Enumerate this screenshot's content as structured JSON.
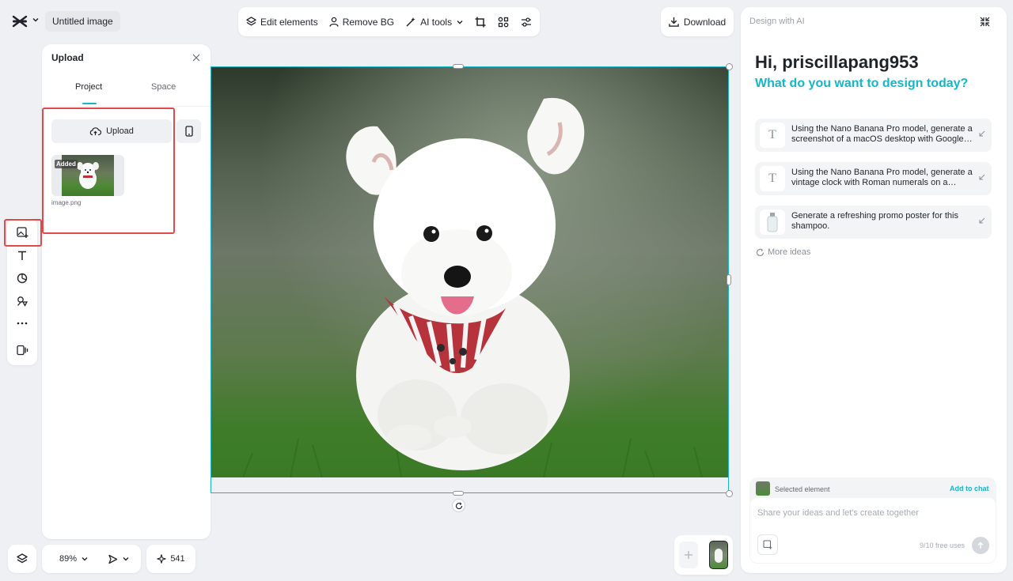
{
  "header": {
    "title": "Untitled image"
  },
  "toolbar": {
    "edit_elements": "Edit elements",
    "remove_bg": "Remove BG",
    "ai_tools": "AI tools",
    "download": "Download"
  },
  "upload_panel": {
    "title": "Upload",
    "tabs": [
      "Project",
      "Space"
    ],
    "active_tab": "Project",
    "upload_button": "Upload",
    "file": {
      "badge": "Added",
      "name": "image.png"
    }
  },
  "bottom": {
    "zoom": "89%",
    "credits": "541"
  },
  "ai_panel": {
    "heading": "Design with AI",
    "greeting": "Hi, priscillapang953",
    "subheading": "What do you want to design today?",
    "suggestions": [
      {
        "icon": "text-icon",
        "text": "Using the Nano Banana Pro model, generate a screenshot of a macOS desktop with Google…"
      },
      {
        "icon": "text-icon",
        "text": "Using the Nano Banana Pro model, generate a vintage clock with Roman numerals on a…"
      },
      {
        "icon": "product-thumbnail",
        "text": "Generate a refreshing promo poster for this shampoo."
      }
    ],
    "more_ideas": "More ideas",
    "selected_element": "Selected element",
    "add_to_chat": "Add to chat",
    "input_placeholder": "Share your ideas and let's create together",
    "free_uses": "9/10 free uses"
  },
  "colors": {
    "accent": "#17b5c8",
    "highlight": "#e24a4a"
  }
}
